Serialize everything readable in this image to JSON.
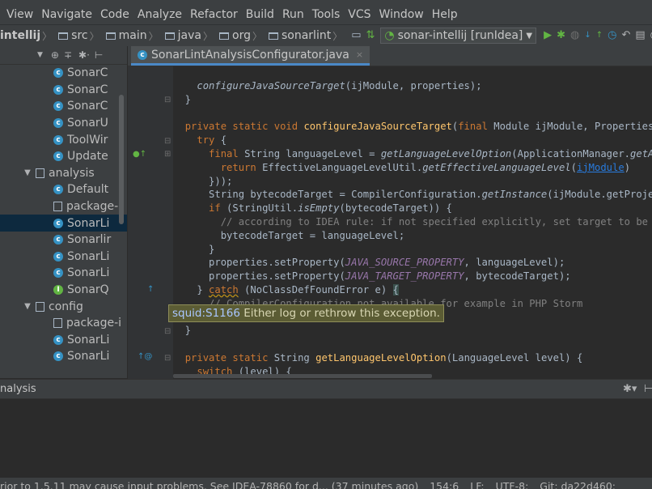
{
  "menu": [
    "View",
    "Navigate",
    "Code",
    "Analyze",
    "Refactor",
    "Build",
    "Run",
    "Tools",
    "VCS",
    "Window",
    "Help"
  ],
  "breadcrumbs": {
    "project": "intellij",
    "items": [
      "src",
      "main",
      "java",
      "org",
      "sonarlint"
    ]
  },
  "run_config": "sonar-intellij [runIdea]",
  "project_tree": {
    "rows": [
      {
        "label": "SonarC",
        "kind": "class"
      },
      {
        "label": "SonarC",
        "kind": "class"
      },
      {
        "label": "SonarC",
        "kind": "class"
      },
      {
        "label": "SonarU",
        "kind": "class"
      },
      {
        "label": "ToolWir",
        "kind": "class"
      },
      {
        "label": "Update",
        "kind": "class"
      },
      {
        "label": "analysis",
        "kind": "package"
      },
      {
        "label": "Default",
        "kind": "class"
      },
      {
        "label": "package-i",
        "kind": "file"
      },
      {
        "label": "SonarLi",
        "kind": "class",
        "selected": true
      },
      {
        "label": "Sonarlir",
        "kind": "class"
      },
      {
        "label": "SonarLi",
        "kind": "class"
      },
      {
        "label": "SonarLi",
        "kind": "class"
      },
      {
        "label": "SonarQ",
        "kind": "class"
      },
      {
        "label": "config",
        "kind": "package"
      },
      {
        "label": "package-i",
        "kind": "file"
      },
      {
        "label": "SonarLi",
        "kind": "class"
      },
      {
        "label": "SonarLi",
        "kind": "class"
      }
    ]
  },
  "editor_tab": {
    "label": "SonarLintAnalysisConfigurator.java",
    "close": "×"
  },
  "tooltip": {
    "rule": "squid:S1166",
    "message": " Either log or rethrow this exception."
  },
  "bottom_panel": {
    "title": "nalysis"
  },
  "status": {
    "message": "rior to 1.5.11 may cause input problems. See IDEA-78860 for d... (37 minutes ago)",
    "position": "154:6",
    "line_sep": "LF:",
    "encoding": "UTF-8:",
    "git": "Git: da22d460:"
  },
  "colors": {
    "keyword": "#cc7832",
    "function": "#ffc66d",
    "constant": "#9876aa",
    "comment": "#808080",
    "accent": "#4a88c7"
  }
}
